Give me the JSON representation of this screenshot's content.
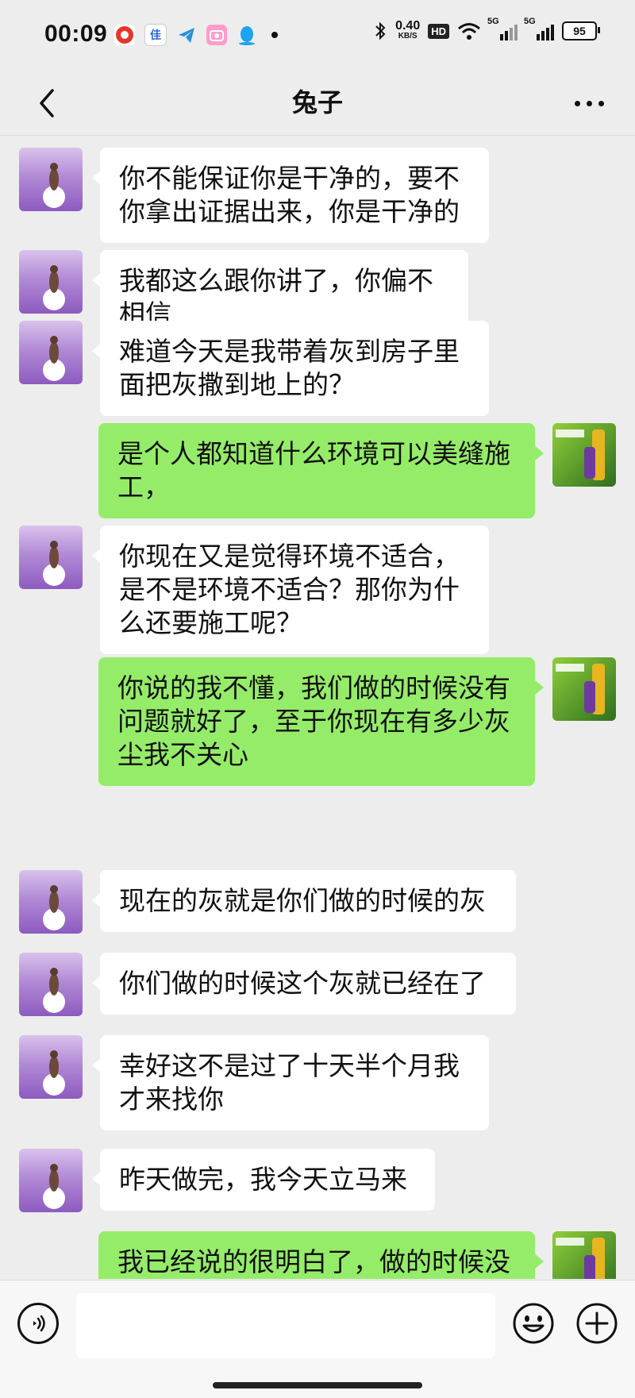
{
  "status_bar": {
    "time": "00:09",
    "net_speed_value": "0.40",
    "net_speed_unit": "KB/S",
    "hd_label": "HD",
    "signal1_label": "5G",
    "signal2_label": "5G",
    "battery": "95",
    "notif_app2_text": "佳"
  },
  "header": {
    "title": "兔子"
  },
  "messages": [
    {
      "side": "left",
      "text": "你不能保证你是干净的，要不你拿出证据出来，你是干净的"
    },
    {
      "side": "left",
      "text": "我都这么跟你讲了，你偏不相信"
    },
    {
      "side": "left",
      "text": "难道今天是我带着灰到房子里面把灰撒到地上的？"
    },
    {
      "side": "right",
      "text": "是个人都知道什么环境可以美缝施工，"
    },
    {
      "side": "left",
      "text": "你现在又是觉得环境不适合，是不是环境不适合？那你为什么还要施工呢？"
    },
    {
      "side": "right",
      "text": "你说的我不懂，我们做的时候没有问题就好了，至于你现在有多少灰尘我不关心"
    },
    {
      "side": "left",
      "text": "现在的灰就是你们做的时候的灰"
    },
    {
      "side": "left",
      "text": "你们做的时候这个灰就已经在了"
    },
    {
      "side": "left",
      "text": "幸好这不是过了十天半个月我才来找你"
    },
    {
      "side": "left",
      "text": "昨天做完，我今天立马来"
    },
    {
      "side": "right",
      "text": "我已经说的很明白了，做的时候没"
    }
  ],
  "icons": {
    "back": "chevron-left-icon",
    "more": "more-dots-icon",
    "voice": "voice-input-icon",
    "emoji": "emoji-icon",
    "plus": "plus-icon"
  },
  "colors": {
    "self_bubble": "#95ec69",
    "other_bubble": "#ffffff",
    "background": "#ededed"
  }
}
